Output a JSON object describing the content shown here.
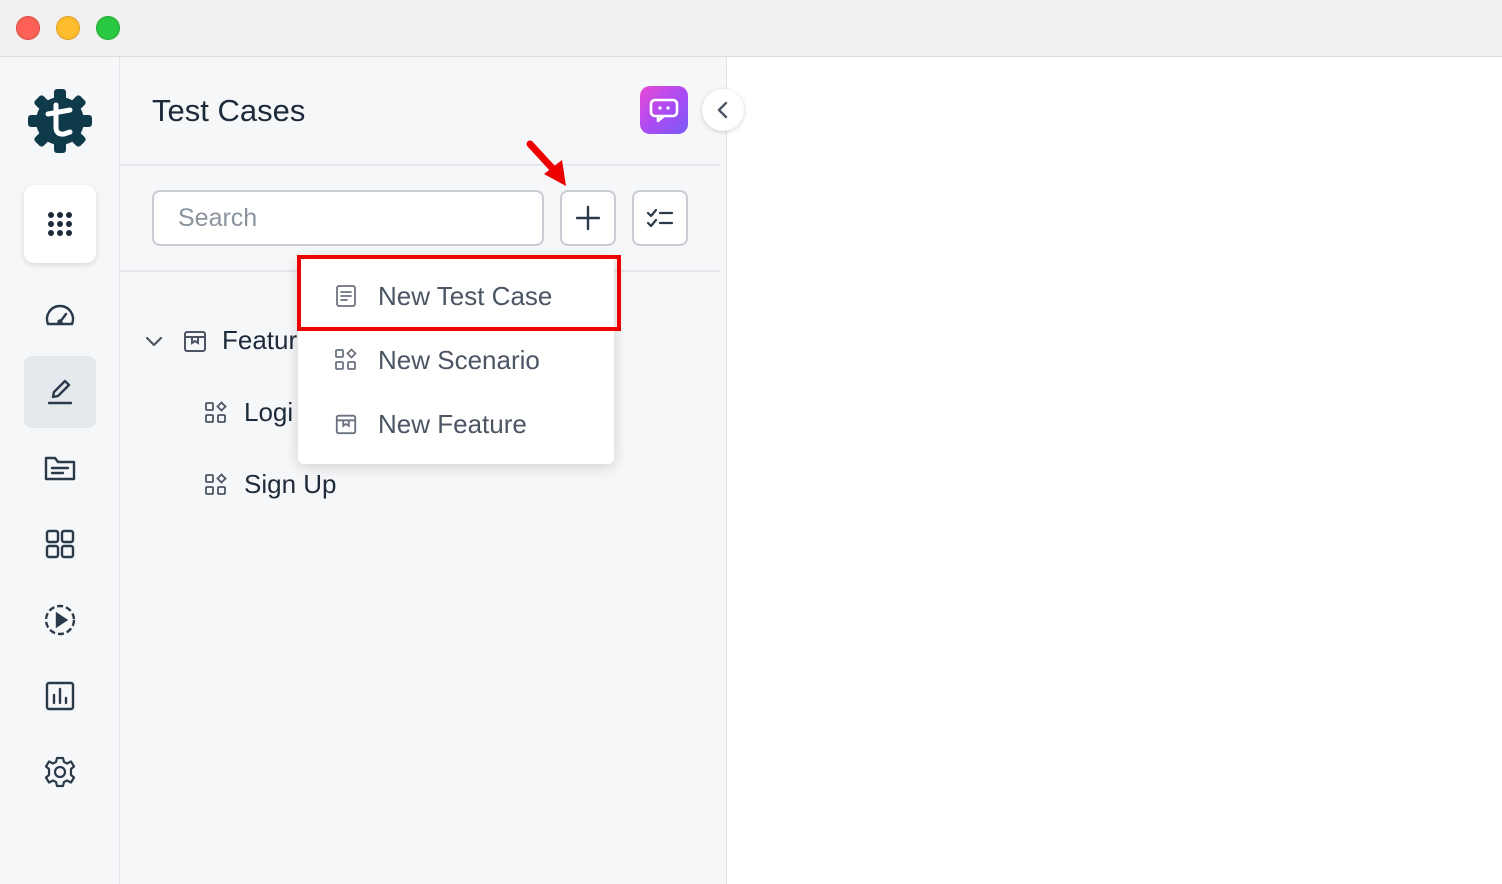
{
  "panel": {
    "title": "Test Cases"
  },
  "search": {
    "placeholder": "Search"
  },
  "tree": {
    "feature_label": "Featur",
    "scenarios": [
      "Logi",
      "Sign Up"
    ]
  },
  "dropdown": {
    "items": [
      "New Test Case",
      "New Scenario",
      "New Feature"
    ]
  },
  "icons": {
    "rail": [
      "grid-apps-icon",
      "dashboard-gauge-icon",
      "edit-pen-icon",
      "folder-icon",
      "apps-grid-icon",
      "play-circle-icon",
      "bar-chart-icon",
      "gear-icon"
    ],
    "toolbar": [
      "plus-icon",
      "checklist-icon"
    ],
    "panel": [
      "chatbot-icon",
      "chevron-left-icon"
    ]
  },
  "colors": {
    "accent_dark": "#0f3a4a",
    "text": "#1d2a3a",
    "highlight": "#ee0000",
    "bot_gradient_start": "#e94bd6",
    "bot_gradient_end": "#7b5cf5"
  }
}
